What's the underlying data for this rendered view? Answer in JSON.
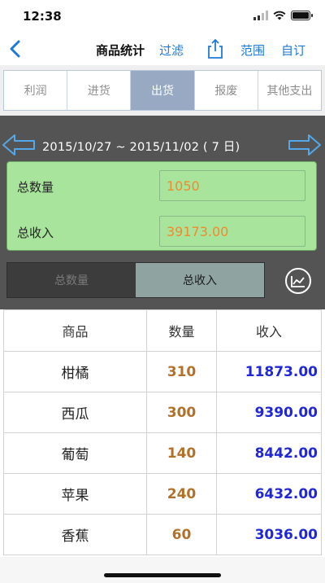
{
  "status": {
    "time": "12:38"
  },
  "nav": {
    "title": "商品统计",
    "filter": "过滤",
    "range": "范围",
    "custom": "自订"
  },
  "tabs": [
    {
      "label": "利润",
      "active": false
    },
    {
      "label": "进货",
      "active": false
    },
    {
      "label": "出货",
      "active": true
    },
    {
      "label": "报废",
      "active": false
    },
    {
      "label": "其他支出",
      "active": false
    }
  ],
  "period": {
    "range": "2015/10/27 ~ 2015/11/02 ( 7 日)"
  },
  "summary": {
    "qty_label": "总数量",
    "qty_value": "1050",
    "income_label": "总收入",
    "income_value": "39173.00"
  },
  "segment": {
    "qty": "总数量",
    "income": "总收入",
    "selected": "income"
  },
  "table": {
    "headers": {
      "product": "商品",
      "qty": "数量",
      "income": "收入"
    },
    "rows": [
      {
        "product": "柑橘",
        "qty": "310",
        "income": "11873.00"
      },
      {
        "product": "西瓜",
        "qty": "300",
        "income": "9390.00"
      },
      {
        "product": "葡萄",
        "qty": "140",
        "income": "8442.00"
      },
      {
        "product": "苹果",
        "qty": "240",
        "income": "6432.00"
      },
      {
        "product": "香蕉",
        "qty": "60",
        "income": "3036.00"
      }
    ]
  },
  "icons": {
    "back": "chevron-left-icon",
    "share": "share-icon",
    "prev": "arrow-left-icon",
    "next": "arrow-right-icon",
    "chart": "chart-icon"
  },
  "colors": {
    "accent": "#1e7ad6",
    "tab_active": "#97a9c3",
    "panel": "#545454",
    "summary_bg": "#a8e49c",
    "value_orange": "#f28a2c",
    "qty_brown": "#b27128",
    "income_blue": "#1f27d6"
  }
}
